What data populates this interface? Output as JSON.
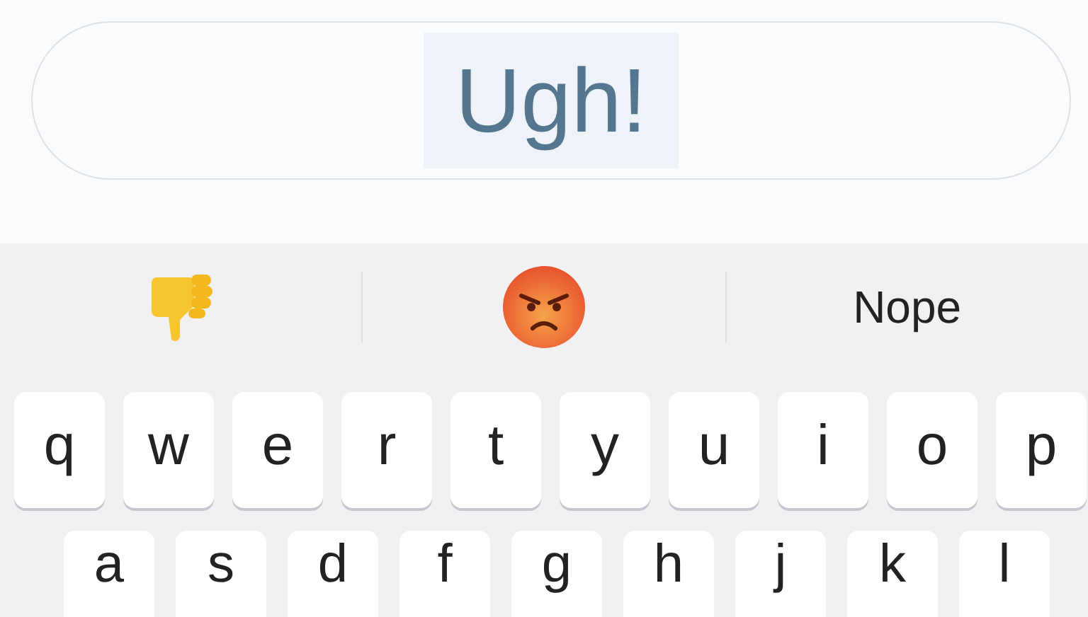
{
  "field": {
    "value": "Ugh!",
    "text_selected": true
  },
  "suggestions": [
    {
      "kind": "thumbs_down"
    },
    {
      "kind": "angry_face"
    },
    {
      "kind": "word",
      "text": "Nope"
    }
  ],
  "keyboard_rows": [
    [
      "q",
      "w",
      "e",
      "r",
      "t",
      "y",
      "u",
      "i",
      "o",
      "p"
    ],
    [
      "a",
      "s",
      "d",
      "f",
      "g",
      "h",
      "j",
      "k",
      "l"
    ]
  ]
}
